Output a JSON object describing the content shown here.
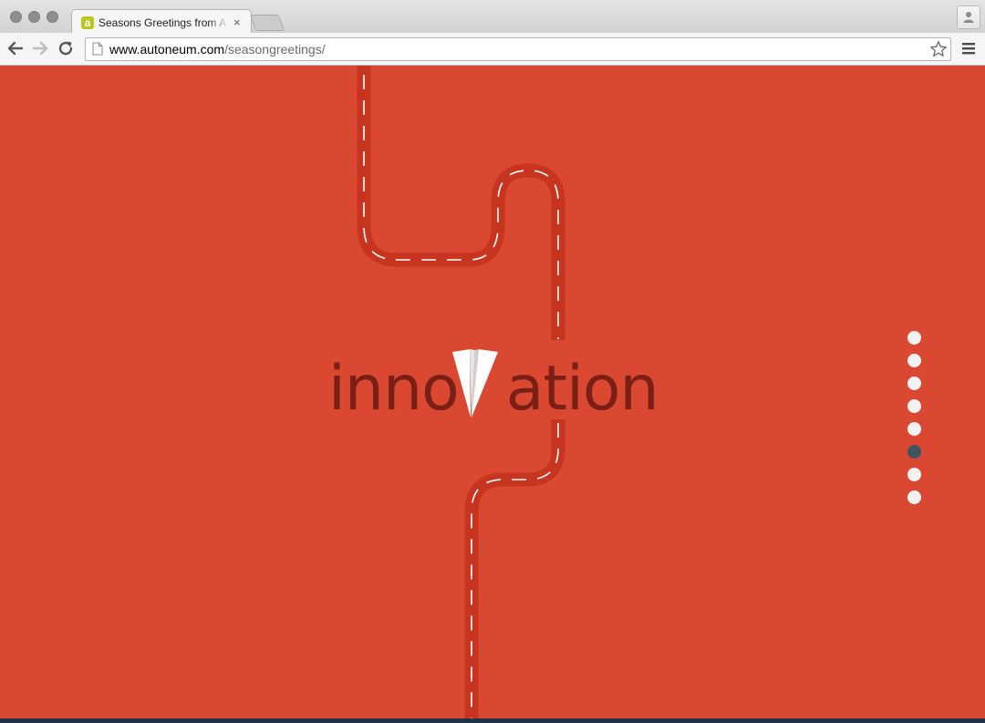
{
  "browser": {
    "tab": {
      "title": "Seasons Greetings from Autoneum",
      "favicon_letter": "a",
      "favicon_color": "#b7c91f",
      "close_glyph": "×"
    },
    "address_bar": {
      "host": "www.autoneum.com",
      "path": "/seasongreetings/"
    },
    "icons": [
      "back-arrow-icon",
      "forward-arrow-icon",
      "reload-icon",
      "page-icon",
      "star-icon",
      "menu-icon",
      "profile-icon"
    ]
  },
  "page": {
    "background_color": "#da4832",
    "road_color": "#c7341f",
    "lane_marking_color": "#ffffff",
    "wordmark": {
      "before": "inno",
      "after": "ation",
      "color": "#7a1f15"
    },
    "pagination": {
      "total": 8,
      "active_index": 5,
      "dot_color": "#f2f2f2",
      "active_color": "#3e5561"
    },
    "bottom_bar_color": "#1f3447"
  }
}
